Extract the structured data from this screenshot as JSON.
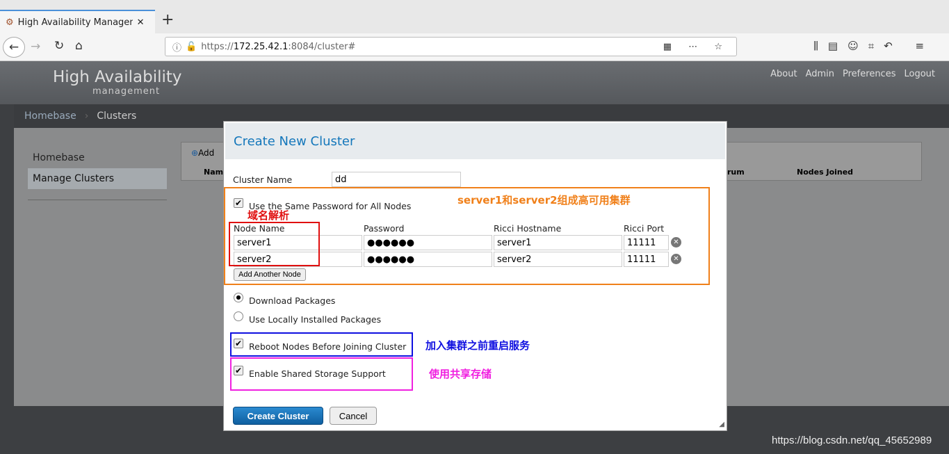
{
  "browser": {
    "tab_title": "High Availability Managem",
    "url_prefix": "https://",
    "url_host": "172.25.42.1",
    "url_rest": ":8084/cluster#"
  },
  "app": {
    "logo_title": "High Availability",
    "logo_sub": "management",
    "top_links": [
      "About",
      "Admin",
      "Preferences",
      "Logout"
    ],
    "breadcrumb": [
      "Homebase",
      "Clusters"
    ],
    "sidebar": [
      "Homebase",
      "Manage Clusters"
    ],
    "add_label": "Add",
    "col_name": "Nam",
    "col_quorum": "rum",
    "col_nodes": "Nodes Joined"
  },
  "modal": {
    "title": "Create New Cluster",
    "cluster_name_label": "Cluster Name",
    "cluster_name": "dd",
    "same_password": "Use the Same Password for All Nodes",
    "headers": [
      "Node Name",
      "Password",
      "Ricci Hostname",
      "Ricci Port"
    ],
    "nodes": [
      {
        "name": "server1",
        "password": "●●●●●●",
        "host": "server1",
        "port": "11111"
      },
      {
        "name": "server2",
        "password": "●●●●●●",
        "host": "server2",
        "port": "11111"
      }
    ],
    "add_node": "Add Another Node",
    "download": "Download Packages",
    "local": "Use Locally Installed Packages",
    "reboot": "Reboot Nodes Before Joining Cluster",
    "shared": "Enable Shared Storage Support",
    "create": "Create Cluster",
    "cancel": "Cancel"
  },
  "annotations": {
    "orange": "server1和server2组成高可用集群",
    "red": "域名解析",
    "blue": "加入集群之前重启服务",
    "magenta": "使用共享存储",
    "watermark": "https://blog.csdn.net/qq_45652989"
  },
  "colors": {
    "orange": "#f0801a",
    "red": "#e01010",
    "blue": "#1010e0",
    "magenta": "#f020e0",
    "accent": "#1477bb"
  }
}
